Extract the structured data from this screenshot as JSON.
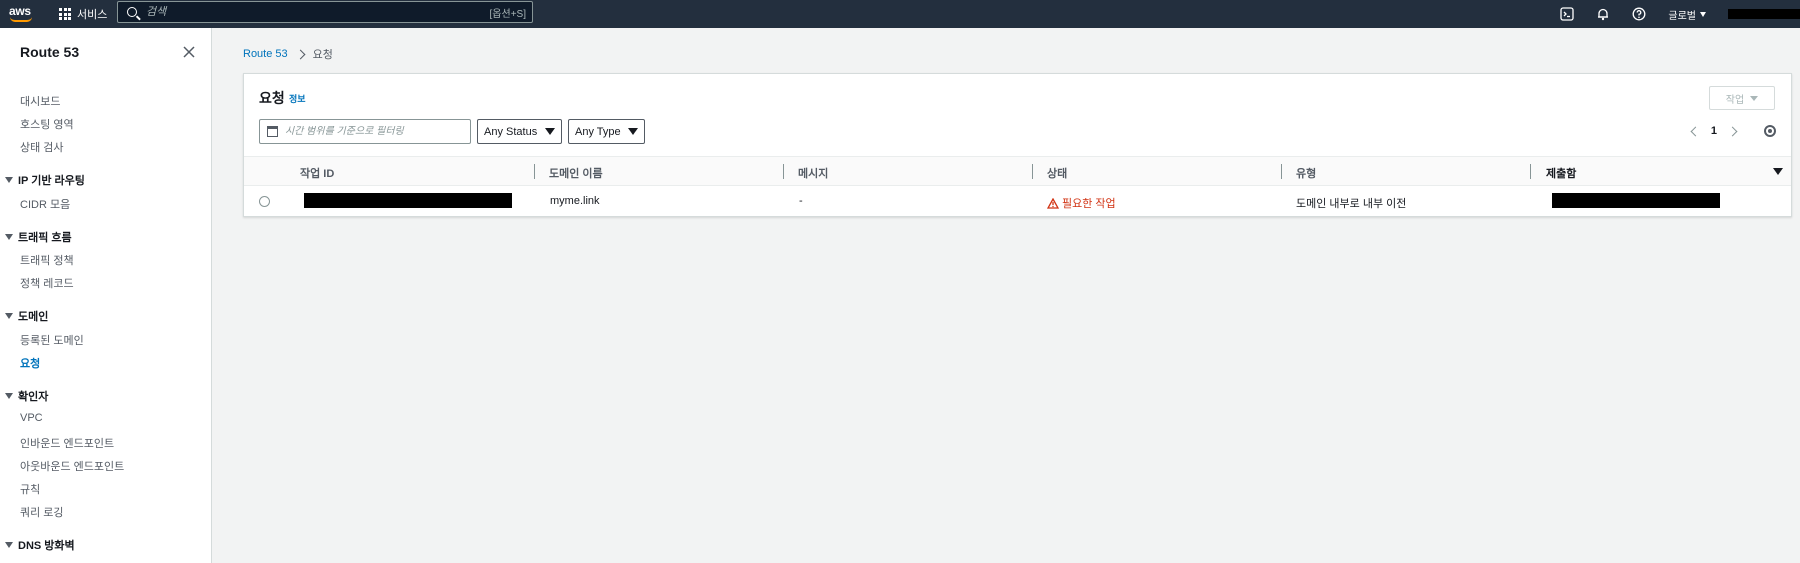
{
  "topnav": {
    "logo_text": "aws",
    "services_label": "서비스",
    "search_placeholder": "검색",
    "search_shortcut": "[옵션+S]",
    "region_label": "글로벌"
  },
  "sidebar": {
    "title": "Route 53",
    "items_top": [
      {
        "label": "대시보드"
      },
      {
        "label": "호스팅 영역"
      },
      {
        "label": "상태 검사"
      }
    ],
    "sections": [
      {
        "label": "IP 기반 라우팅",
        "items": [
          {
            "label": "CIDR 모음"
          }
        ]
      },
      {
        "label": "트래픽 흐름",
        "items": [
          {
            "label": "트래픽 정책"
          },
          {
            "label": "정책 레코드"
          }
        ]
      },
      {
        "label": "도메인",
        "items": [
          {
            "label": "등록된 도메인"
          },
          {
            "label": "요청"
          }
        ]
      },
      {
        "label": "확인자",
        "items": [
          {
            "label": "VPC"
          },
          {
            "label": "인바운드 엔드포인트"
          },
          {
            "label": "아웃바운드 엔드포인트"
          },
          {
            "label": "규칙"
          },
          {
            "label": "쿼리 로깅"
          }
        ]
      },
      {
        "label": "DNS 방화벽",
        "items": []
      }
    ],
    "active_item": "요청"
  },
  "breadcrumb": {
    "root": "Route 53",
    "current": "요청"
  },
  "panel": {
    "title": "요청",
    "info_link": "정보",
    "action_button": "작업",
    "filter_placeholder": "시간 범위를 기준으로 필터링",
    "status_select": "Any Status",
    "type_select": "Any Type",
    "page_number": "1"
  },
  "table": {
    "columns": [
      "작업 ID",
      "도메인 이름",
      "메시지",
      "상태",
      "유형",
      "제출함"
    ],
    "rows": [
      {
        "job_id": "",
        "domain": "myme.link",
        "message": "-",
        "status": "필요한 작업",
        "type": "도메인 내부로 내부 이전",
        "submitted": ""
      }
    ]
  },
  "colors": {
    "nav_bg": "#232f3e",
    "accent_link": "#0073bb",
    "warning": "#d13212",
    "aws_orange": "#ff9900"
  }
}
